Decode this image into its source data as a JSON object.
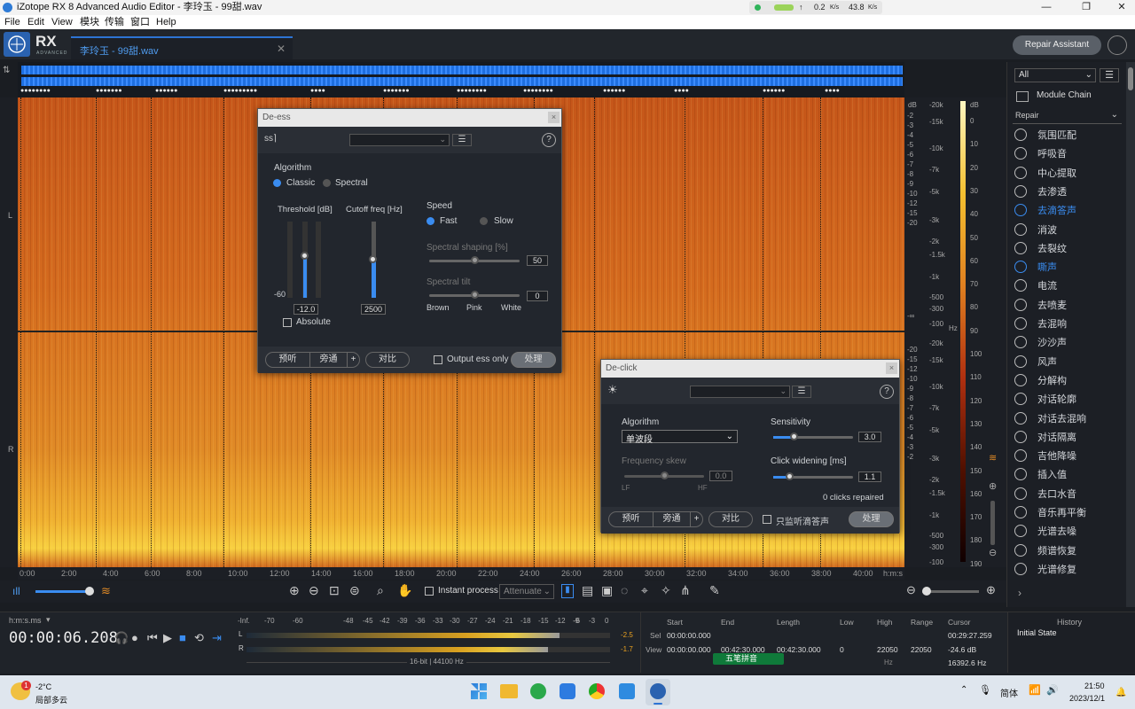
{
  "window": {
    "title": "iZotope RX 8 Advanced Audio Editor - 李玲玉 - 99甜.wav",
    "min": "—",
    "max": "❐",
    "close": "✕"
  },
  "net": {
    "up": "0.2",
    "up_unit": "K/s",
    "down": "43.8",
    "down_unit": "K/s"
  },
  "menu": [
    "File",
    "Edit",
    "View",
    "模块",
    "传输",
    "窗口",
    "Help"
  ],
  "app": {
    "logo": "RX",
    "logo_sub": "ADVANCED",
    "file_tab": "李玲玉 - 99甜.wav",
    "tab_close": "✕",
    "repair_assistant": "Repair Assistant"
  },
  "overview": {
    "markers": [
      "●●●●●●●●",
      "●●●●●●●",
      "●●●●●●",
      "●●●●●●●●●",
      "●●●●",
      "●●●●●●●",
      "●●●●●●●●",
      "●●●●●●●●",
      "●●●●●●",
      "●●●●",
      "●●●●●●",
      "●●●●"
    ]
  },
  "channels": {
    "left": "L",
    "right": "R"
  },
  "scale": {
    "db_unit": "dB",
    "hz_unit": "Hz",
    "left_db": [
      "-2",
      "-3",
      "-4",
      "-5",
      "-6",
      "-7",
      "-8",
      "-9",
      "-10",
      "-12",
      "-15",
      "-20",
      "-∞",
      "-20",
      "-15",
      "-12",
      "-10",
      "-9",
      "-8",
      "-7",
      "-6",
      "-5",
      "-4",
      "-3",
      "-2"
    ],
    "hz": [
      "-20k",
      "-15k",
      "-10k",
      "-7k",
      "-5k",
      "-3k",
      "-2k",
      "-1.5k",
      "-1k",
      "-500",
      "-300",
      "-100"
    ],
    "right_db": [
      "0",
      "10",
      "20",
      "30",
      "40",
      "50",
      "60",
      "70",
      "80",
      "90",
      "100",
      "110",
      "120",
      "130",
      "140",
      "150",
      "160",
      "170",
      "180",
      "190"
    ]
  },
  "timeline": {
    "ticks": [
      "0:00",
      "2:00",
      "4:00",
      "6:00",
      "8:00",
      "10:00",
      "12:00",
      "14:00",
      "16:00",
      "18:00",
      "20:00",
      "22:00",
      "24:00",
      "26:00",
      "28:00",
      "30:00",
      "32:00",
      "34:00",
      "36:00",
      "38:00",
      "40:00"
    ],
    "unit": "h:m:s"
  },
  "toolbar": {
    "instant_process": "Instant process",
    "attenuate": "Attenuate"
  },
  "deess": {
    "title": "De-ess",
    "close": "×",
    "algorithm": "Algorithm",
    "classic": "Classic",
    "spectral": "Spectral",
    "threshold": "Threshold [dB]",
    "threshold_min": "-60",
    "threshold_val": "-12.0",
    "threshold_level": 0.55,
    "absolute": "Absolute",
    "cutoff": "Cutoff freq [Hz]",
    "cutoff_val": "2500",
    "cutoff_level": 0.5,
    "speed": "Speed",
    "fast": "Fast",
    "slow": "Slow",
    "shaping": "Spectral shaping [%]",
    "shaping_val": "50",
    "tilt": "Spectral tilt",
    "tilt_val": "0",
    "brown": "Brown",
    "pink": "Pink",
    "white": "White",
    "preview": "预听",
    "bypass": "旁通",
    "plus": "+",
    "compare": "对比",
    "output_only": "Output ess only",
    "process": "处理",
    "help": "?"
  },
  "declick": {
    "title": "De-click",
    "close": "×",
    "algorithm": "Algorithm",
    "algo_value": "单波段",
    "sensitivity": "Sensitivity",
    "sensitivity_val": "3.0",
    "freq_skew": "Frequency skew",
    "skew_val": "0.0",
    "lf": "LF",
    "hf": "HF",
    "click_widening": "Click widening [ms]",
    "widening_val": "1.1",
    "repaired": "0 clicks repaired",
    "preview": "预听",
    "bypass": "旁通",
    "plus": "+",
    "compare": "对比",
    "monitor": "只监听滴答声",
    "process": "处理",
    "help": "?"
  },
  "sidebar": {
    "filter": "All",
    "module_chain": "Module Chain",
    "repair": "Repair",
    "items": [
      "氛围匹配",
      "呼吸音",
      "中心提取",
      "去渗透",
      "去滴答声",
      "消波",
      "去裂纹",
      "嘶声",
      "电流",
      "去喷麦",
      "去混响",
      "沙沙声",
      "风声",
      "分解构",
      "对话轮廓",
      "对话去混响",
      "对话隔离",
      "吉他降噪",
      "插入值",
      "去口水音",
      "音乐再平衡",
      "光谱去噪",
      "频谱恢复",
      "光谱修复"
    ]
  },
  "transport": {
    "format": "h:m:s.ms",
    "time": "00:00:06.208"
  },
  "meters": {
    "scale": [
      "-Inf.",
      "-70",
      "-60",
      "-48",
      "-45",
      "-42",
      "-39",
      "-36",
      "-33",
      "-30",
      "-27",
      "-24",
      "-21",
      "-18",
      "-15",
      "-12",
      "-9",
      "-6",
      "-3",
      "0"
    ],
    "l_peak": "-2.5",
    "r_peak": "-1.7",
    "l_level": 0.86,
    "r_level": 0.83,
    "format": "16-bit | 44100 Hz",
    "l": "L",
    "r": "R"
  },
  "selection": {
    "start_h": "Start",
    "end_h": "End",
    "length_h": "Length",
    "low_h": "Low",
    "high_h": "High",
    "range_h": "Range",
    "cursor_h": "Cursor",
    "sel": "Sel",
    "view": "View",
    "sel_start": "00:00:00.000",
    "view_start": "00:00:00.000",
    "view_end": "00:42:30.000",
    "view_length": "00:42:30.000",
    "low": "0",
    "high": "22050",
    "range": "22050",
    "hz": "Hz",
    "cursor_time": "00:29:27.259",
    "cursor_db": "-24.6 dB",
    "cursor_hz": "16392.6 Hz"
  },
  "history": {
    "title": "History",
    "item": "Initial State"
  },
  "ime": {
    "label": "五笔拼音"
  },
  "taskbar": {
    "temp": "-2°C",
    "weather": "局部多云",
    "badge": "1",
    "lang": "简体",
    "time": "21:50",
    "date": "2023/12/1"
  }
}
